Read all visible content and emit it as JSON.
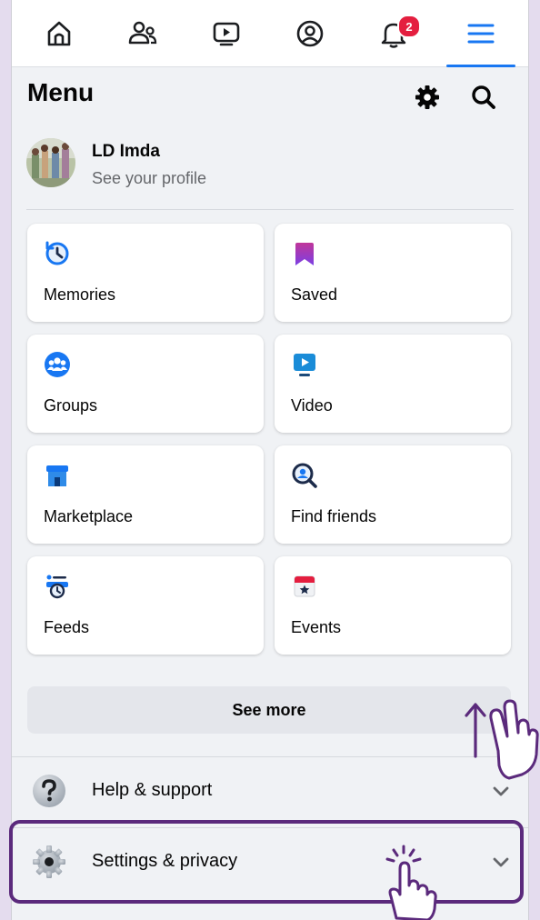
{
  "topnav": {
    "items": [
      {
        "name": "home"
      },
      {
        "name": "friends"
      },
      {
        "name": "video"
      },
      {
        "name": "profile"
      },
      {
        "name": "notifications",
        "badge": "2"
      },
      {
        "name": "menu",
        "active": true
      }
    ]
  },
  "header": {
    "title": "Menu"
  },
  "profile": {
    "name": "LD Imda",
    "subtitle": "See your profile"
  },
  "shortcuts": [
    {
      "label": "Memories",
      "icon": "memories-icon"
    },
    {
      "label": "Saved",
      "icon": "saved-icon"
    },
    {
      "label": "Groups",
      "icon": "groups-icon"
    },
    {
      "label": "Video",
      "icon": "video-icon"
    },
    {
      "label": "Marketplace",
      "icon": "marketplace-icon"
    },
    {
      "label": "Find friends",
      "icon": "find-friends-icon"
    },
    {
      "label": "Feeds",
      "icon": "feeds-icon"
    },
    {
      "label": "Events",
      "icon": "events-icon"
    }
  ],
  "see_more": {
    "label": "See more"
  },
  "sections": [
    {
      "label": "Help & support",
      "icon": "help-icon"
    },
    {
      "label": "Settings & privacy",
      "icon": "settings-gear-icon"
    }
  ],
  "colors": {
    "accent": "#1877f2",
    "badge": "#e41e3f",
    "annotation": "#5b2a7c",
    "background": "#f0f2f5"
  }
}
